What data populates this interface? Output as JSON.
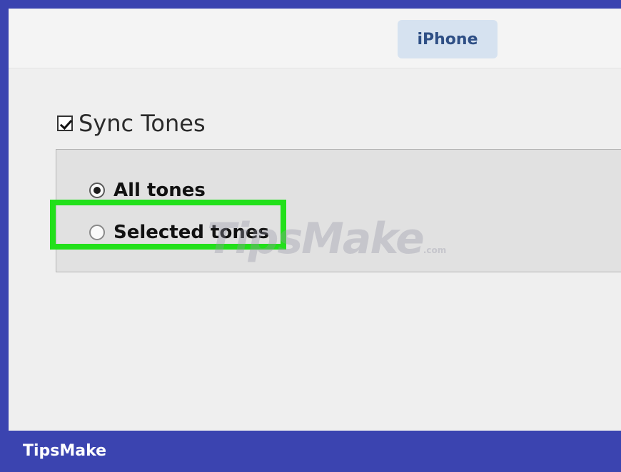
{
  "header": {
    "tab_label": "iPhone"
  },
  "sync": {
    "label": "Sync Tones",
    "checked": true
  },
  "options": {
    "all_label": "All tones",
    "selected_label": "Selected tones",
    "selected_value": "All tones"
  },
  "watermark": {
    "text": "TipsMake",
    "suffix": ".com"
  },
  "footer": {
    "brand": "TipsMake"
  },
  "colors": {
    "frame": "#3b44b0",
    "highlight": "#22e01a",
    "tab_bg": "#d6e2f0"
  }
}
